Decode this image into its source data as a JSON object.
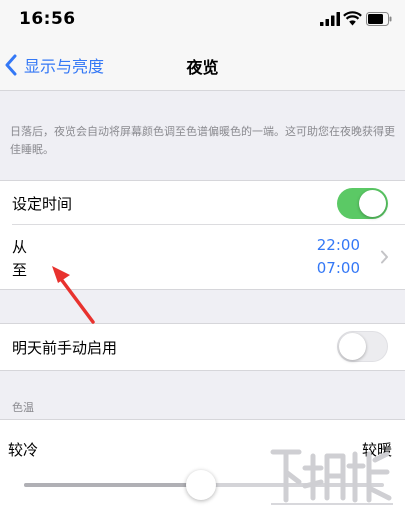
{
  "status_bar": {
    "time": "16:56",
    "icons": [
      "signal-icon",
      "wifi-icon",
      "battery-icon"
    ]
  },
  "nav": {
    "back_label": "显示与亮度",
    "title": "夜览"
  },
  "description": "日落后，夜览会自动将屏幕颜色调至色谱偏暖色的一端。这可助您在夜晚获得更佳睡眠。",
  "schedule": {
    "label": "设定时间",
    "enabled": true,
    "from_label": "从",
    "to_label": "至",
    "from_time": "22:00",
    "to_time": "07:00"
  },
  "manual": {
    "label": "明天前手动启用",
    "enabled": false
  },
  "color_temperature": {
    "header": "色温",
    "min_label": "较冷",
    "max_label": "较暖",
    "level": 0.49
  },
  "colors": {
    "accent": "#3478f6",
    "toggle_on": "#5bc965",
    "background": "#efeff4",
    "annotation": "#e8322e"
  }
}
